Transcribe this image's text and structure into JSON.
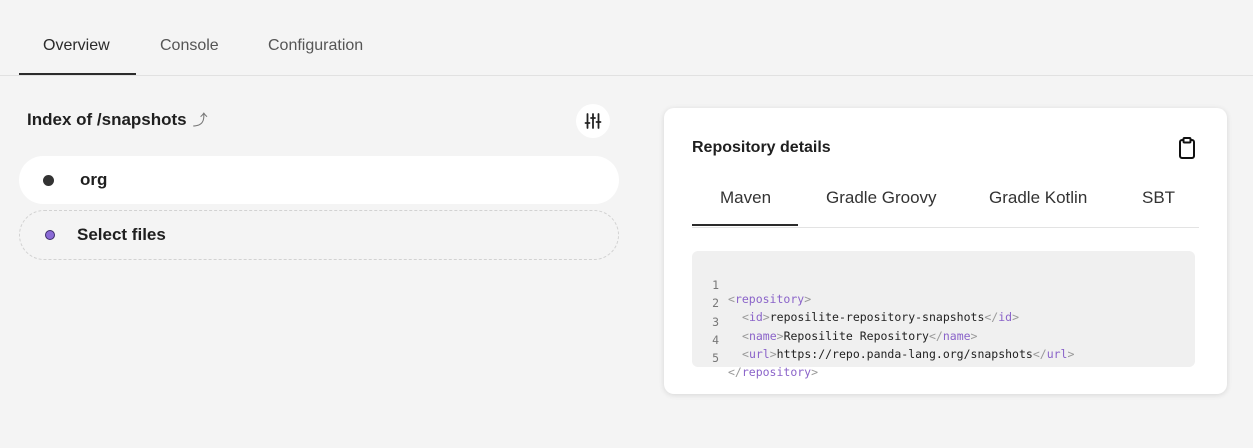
{
  "tabs": {
    "overview": "Overview",
    "console": "Console",
    "configuration": "Configuration"
  },
  "index": {
    "title": "Index of /snapshots",
    "up_icon": "⤴"
  },
  "files": [
    {
      "name": "org"
    }
  ],
  "select_files": "Select files",
  "details": {
    "title": "Repository details",
    "tabs": [
      "Maven",
      "Gradle Groovy",
      "Gradle Kotlin",
      "SBT"
    ],
    "code": {
      "ln1": "1",
      "ln2": "2",
      "ln3": "3",
      "ln4": "4",
      "ln5": "5",
      "lt": "<",
      "ltslash": "</",
      "gt": ">",
      "repository_tag": "repository",
      "id_tag": "id",
      "name_tag": "name",
      "url_tag": "url",
      "id_value": "reposilite-repository-snapshots",
      "name_value": "Reposilite Repository",
      "url_value": "https://repo.panda-lang.org/snapshots"
    }
  },
  "colors": {
    "background": "#f4f4f4",
    "accent_purple": "#8a6ad6",
    "tag_color": "#8a63c9"
  },
  "icons": {
    "settings": "sliders-icon",
    "clipboard": "clipboard-icon",
    "up": "arrow-up-icon"
  }
}
